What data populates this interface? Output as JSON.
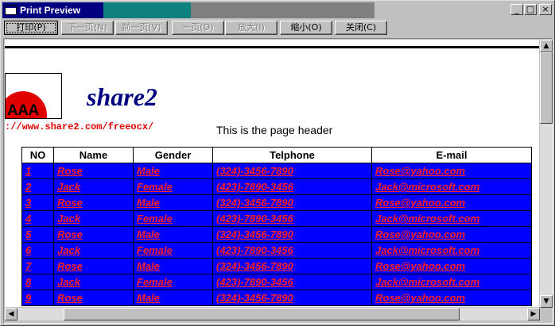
{
  "window": {
    "title": "Print Preview"
  },
  "titlebar_buttons": {
    "minimize": "_",
    "maximize": "□",
    "close": "×"
  },
  "toolbar": {
    "buttons": [
      {
        "label": "打印(P)",
        "enabled": true
      },
      {
        "label": "下一页(N)",
        "enabled": false
      },
      {
        "label": "前一页(V)",
        "enabled": false
      },
      {
        "label": "一页(O)",
        "enabled": false
      },
      {
        "label": "放大(I)",
        "enabled": false
      },
      {
        "label": "缩小(O)",
        "enabled": true
      },
      {
        "label": "关闭(C)",
        "enabled": true
      }
    ]
  },
  "page": {
    "logo_text": "AAA",
    "brand": "share2",
    "url": "://www.share2.com/freeocx/",
    "header_text": "This is the page header",
    "table": {
      "columns": [
        "NO",
        "Name",
        "Gender",
        "Telphone",
        "E-mail"
      ],
      "rows": [
        [
          "1",
          "Rose",
          "Male",
          "(324)-3456-7890",
          "Rose@yahoo.com"
        ],
        [
          "2",
          "Jack",
          "Female",
          "(423)-7890-3456",
          "Jack@microsoft.com"
        ],
        [
          "3",
          "Rose",
          "Male",
          "(324)-3456-7890",
          "Rose@yahoo.com"
        ],
        [
          "4",
          "Jack",
          "Female",
          "(423)-7890-3456",
          "Jack@microsoft.com"
        ],
        [
          "5",
          "Rose",
          "Male",
          "(324)-3456-7890",
          "Rose@yahoo.com"
        ],
        [
          "6",
          "Jack",
          "Female",
          "(423)-7890-3456",
          "Jack@microsoft.com"
        ],
        [
          "7",
          "Rose",
          "Male",
          "(324)-3456-7890",
          "Rose@yahoo.com"
        ],
        [
          "8",
          "Jack",
          "Female",
          "(423)-7890-3456",
          "Jack@microsoft.com"
        ],
        [
          "9",
          "Rose",
          "Male",
          "(324)-3456-7890",
          "Rose@yahoo.com"
        ]
      ]
    }
  },
  "scrollbars": {
    "up": "▲",
    "down": "▼",
    "left": "◀",
    "right": "▶"
  },
  "colors": {
    "title_active": "#000080",
    "row_fill": "#0000ff",
    "row_text": "#ff2020",
    "brand": "#000080"
  }
}
